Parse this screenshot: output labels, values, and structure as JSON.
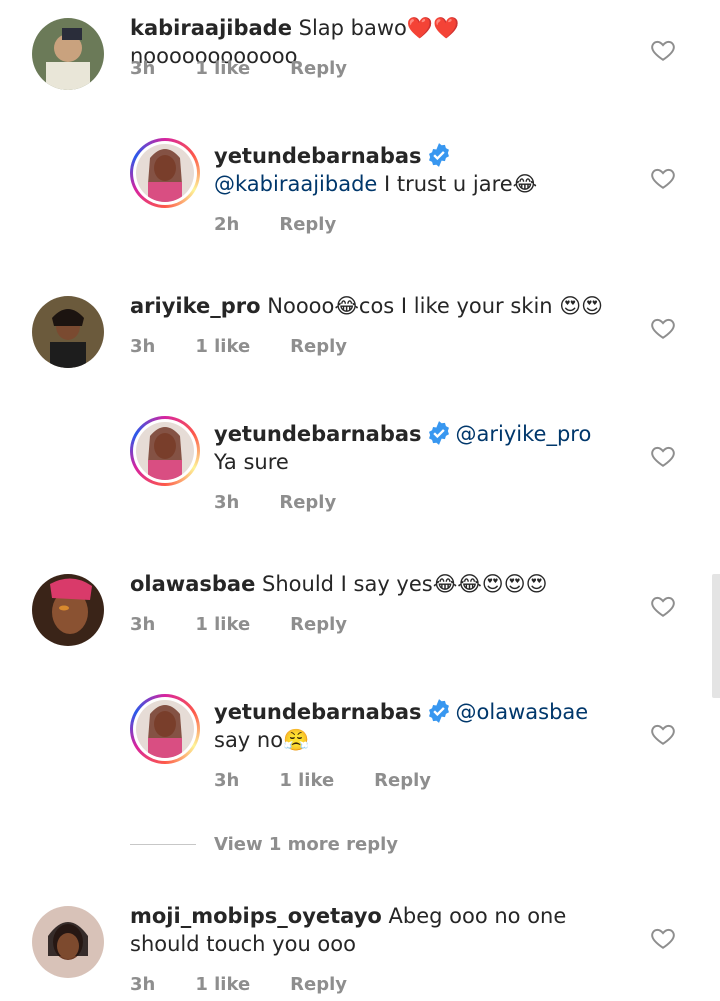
{
  "comments": [
    {
      "user": "kabiraajibade",
      "text": "Slap bawo❤️❤️ noooooooooooo",
      "time": "3h",
      "likes": "1 like",
      "reply": "Reply"
    },
    {
      "user": "yetundebarnabas",
      "mention": "@kabiraajibade",
      "text": " I trust u jare😂",
      "time": "2h",
      "reply": "Reply"
    },
    {
      "user": "ariyike_pro",
      "text": "Noooo😂cos I like your skin 😍😍",
      "time": "3h",
      "likes": "1 like",
      "reply": "Reply"
    },
    {
      "user": "yetundebarnabas",
      "mention": "@ariyike_pro",
      "text": " Ya sure",
      "time": "3h",
      "reply": "Reply"
    },
    {
      "user": "olawasbae",
      "text": "Should I say yes😂😂😍😍😍",
      "time": "3h",
      "likes": "1 like",
      "reply": "Reply"
    },
    {
      "user": "yetundebarnabas",
      "mention": "@olawasbae",
      "text": " say no😤",
      "time": "3h",
      "likes": "1 like",
      "reply": "Reply"
    },
    {
      "user": "moji_mobips_oyetayo",
      "text": "Abeg ooo no one should touch you ooo",
      "time": "3h",
      "likes": "1 like",
      "reply": "Reply"
    }
  ],
  "view_more": "View 1 more reply",
  "icons": {
    "like": "heart-outline-icon",
    "verified": "verified-badge-icon"
  },
  "colors": {
    "mention": "#00376b",
    "verified": "#3897f0",
    "meta": "#8e8e8e"
  }
}
